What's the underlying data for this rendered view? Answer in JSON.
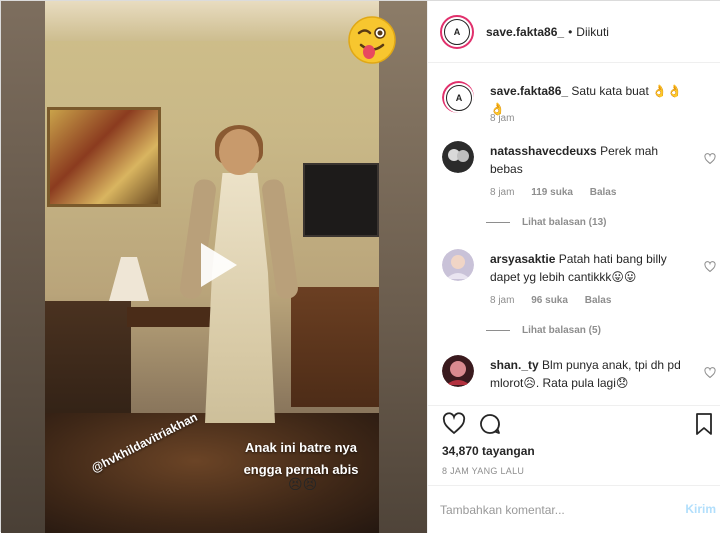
{
  "post": {
    "username": "save.fakta86_",
    "dot": "•",
    "follow_status": "Diikuti",
    "avatar_text": "A"
  },
  "media": {
    "caption_text": "Anak ini batre nya engga pernah abis",
    "caption_emoji": "😣😣",
    "mention": "@hvkhildavitriakhan"
  },
  "caption_comment": {
    "username": "save.fakta86_",
    "text": " Satu kata buat 👌👌👌",
    "time": "8 jam"
  },
  "comments": [
    {
      "username": "natasshavecdeuxs",
      "text": " Perek mah bebas",
      "time": "8 jam",
      "likes": "119 suka",
      "reply": "Balas",
      "view_replies": "Lihat balasan (13)"
    },
    {
      "username": "arsyasaktie",
      "text": " Patah hati bang billy dapet yg lebih cantikkk😛😛",
      "time": "8 jam",
      "likes": "96 suka",
      "reply": "Balas",
      "view_replies": "Lihat balasan (5)"
    },
    {
      "username": "shan._ty",
      "text": " Blm punya anak, tpi dh pd mlorot😥. Rata pula lagi😞"
    }
  ],
  "stats": {
    "views": "34,870 tayangan",
    "time_ago": "8 JAM YANG LALU"
  },
  "comment_box": {
    "placeholder": "Tambahkan komentar...",
    "post_label": "Kirim"
  }
}
